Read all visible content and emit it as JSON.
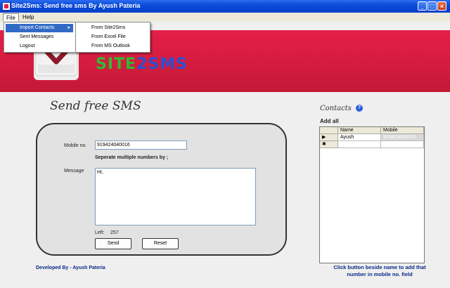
{
  "window": {
    "title": "Site2Sms: Send free sms By Ayush Pateria",
    "minimize_icon": "_",
    "maximize_icon": "□",
    "close_icon": "×"
  },
  "menubar": {
    "file": "File",
    "help": "Help"
  },
  "file_menu": {
    "items": [
      "Import Contacts",
      "Sent Messages",
      "Logout"
    ],
    "submenu_arrow": "▸"
  },
  "import_submenu": {
    "items": [
      "From Site2Sms",
      "From Excel File",
      "From MS Outlook"
    ]
  },
  "banner": {
    "logo_part1": "SITE",
    "logo_part2": "2",
    "logo_part3": "SMS",
    "colors": {
      "banner": "#d41c3e",
      "logo_green": "#2dbb32",
      "logo_blue": "#2b4fd1"
    }
  },
  "form": {
    "heading": "Send free SMS",
    "mobile_label": "Mobile no.",
    "mobile_value": "919424040016",
    "separator_hint": "Seperate multiple numbers by ;",
    "message_label": "Message",
    "message_value": "HI,",
    "left_label": "Left:",
    "left_value": "257",
    "send_button": "Send",
    "reset_button": "Reset"
  },
  "footer": {
    "developed_by": "Developed By - Ayush Pateria"
  },
  "contacts": {
    "title": "Contacts",
    "help_icon": "?",
    "add_all": "Add all",
    "columns": [
      "Name",
      "Mobile"
    ],
    "rows": [
      {
        "name": "Ayush",
        "mobile": "919424040016"
      }
    ],
    "current_row_marker": "▶",
    "new_row_marker": "✱",
    "hint": "Click button beside name to add that number in mobile no. field"
  }
}
